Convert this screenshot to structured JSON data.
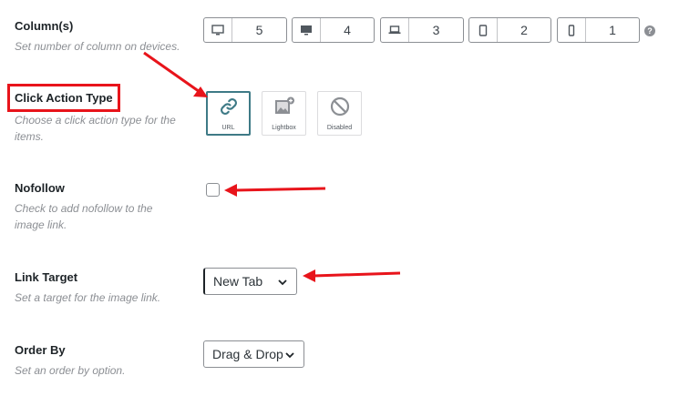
{
  "columns": {
    "label": "Column(s)",
    "description": "Set number of column on devices.",
    "devices": [
      {
        "icon": "desktop-large-icon",
        "value": "5"
      },
      {
        "icon": "desktop-icon",
        "value": "4"
      },
      {
        "icon": "laptop-icon",
        "value": "3"
      },
      {
        "icon": "tablet-icon",
        "value": "2"
      },
      {
        "icon": "mobile-icon",
        "value": "1"
      }
    ],
    "help_icon": "question-circle-icon"
  },
  "click_action": {
    "label": "Click Action Type",
    "description": "Choose a click action type for the items.",
    "options": [
      {
        "icon": "link-icon",
        "label": "URL",
        "selected": true
      },
      {
        "icon": "image-plus-icon",
        "label": "Lightbox",
        "selected": false
      },
      {
        "icon": "disabled-icon",
        "label": "Disabled",
        "selected": false
      }
    ]
  },
  "nofollow": {
    "label": "Nofollow",
    "description": "Check to add nofollow to the image link.",
    "checked": false
  },
  "link_target": {
    "label": "Link Target",
    "description": "Set a target for the image link.",
    "selected": "New Tab"
  },
  "order_by": {
    "label": "Order By",
    "description": "Set an order by option.",
    "selected": "Drag & Drop"
  },
  "colors": {
    "annotation_red": "#e8141b",
    "active_tile_border": "#3e7a86",
    "text": "#1d2327",
    "muted": "#8c8f94"
  }
}
